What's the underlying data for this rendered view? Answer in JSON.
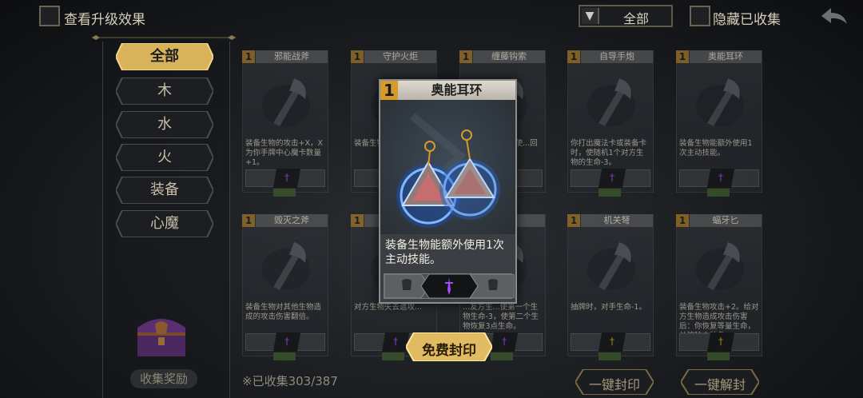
{
  "topbar": {
    "view_upgrade_label": "查看升级效果",
    "filter_value": "全部",
    "hide_collected_label": "隐藏已收集"
  },
  "sidebar": {
    "categories": [
      {
        "label": "全部",
        "active": true
      },
      {
        "label": "木",
        "active": false
      },
      {
        "label": "水",
        "active": false
      },
      {
        "label": "火",
        "active": false
      },
      {
        "label": "装备",
        "active": false
      },
      {
        "label": "心魔",
        "active": false
      }
    ],
    "collect_reward_label": "收集奖励"
  },
  "collected_count": "※已收集303/387",
  "cards": [
    {
      "level": "1",
      "name": "邪能战斧",
      "desc": "装备生物的攻击+X，X为你手牌中心魔卡数量+1。",
      "gem": "purple"
    },
    {
      "level": "1",
      "name": "守护火炬",
      "desc": "装备生物...受到的...",
      "gem": "purple"
    },
    {
      "level": "1",
      "name": "缠藤钩索",
      "desc": "...生物移动...并使...回到原...",
      "gem": "purple"
    },
    {
      "level": "1",
      "name": "自导手炮",
      "desc": "你打出魔法卡或装备卡时，使随机1个对方生物的生命-3。",
      "gem": "purple"
    },
    {
      "level": "1",
      "name": "奥能耳环",
      "desc": "装备生物能额外使用1次主动技能。",
      "gem": "purple"
    },
    {
      "level": "1",
      "name": "毁灭之斧",
      "desc": "装备生物对其他生物造成的攻击伤害翻倍。",
      "gem": "purple"
    },
    {
      "level": "1",
      "name": "",
      "desc": "对方生物失去遗攻...",
      "gem": "purple"
    },
    {
      "level": "1",
      "name": "",
      "desc": "...友方生...使第一个生物生命-3，使第二个生物恢复3点生命。",
      "gem": "purple"
    },
    {
      "level": "1",
      "name": "机关弩",
      "desc": "抽牌时，对手生命-1。",
      "gem": "gold"
    },
    {
      "level": "1",
      "name": "蝠牙匕",
      "desc": "装备生物攻击+2。给对方生物造成攻击伤害后：你恢复等量生命，并移除本装备。",
      "gem": "gold"
    }
  ],
  "popup": {
    "level": "1",
    "name": "奥能耳环",
    "desc": "装备生物能额外使用1次主动技能。"
  },
  "free_seal_label": "免费封印",
  "one_click_seal_label": "一键封印",
  "one_click_unseal_label": "一键解封",
  "colors": {
    "accent_gold": "#d4ad52",
    "gem_purple": "#a24bff",
    "gem_gold": "#e0a52a"
  }
}
